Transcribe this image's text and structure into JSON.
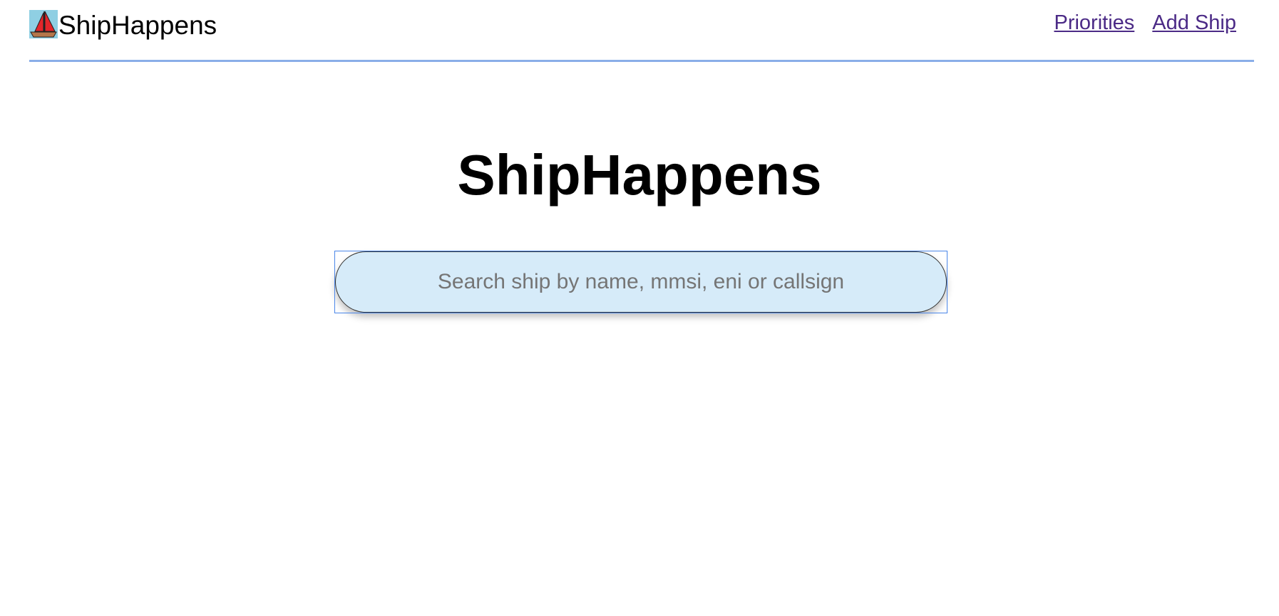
{
  "header": {
    "brand_name": "ShipHappens",
    "logo_icon": "sailboat-icon",
    "nav": [
      {
        "label": "Priorities"
      },
      {
        "label": "Add Ship"
      }
    ],
    "link_color": "#4b2a86",
    "divider_color": "#8aaee8"
  },
  "main": {
    "title": "ShipHappens",
    "search": {
      "placeholder": "Search ship by name, mmsi, eni or callsign",
      "value": "",
      "background": "#d6ebf9"
    }
  }
}
